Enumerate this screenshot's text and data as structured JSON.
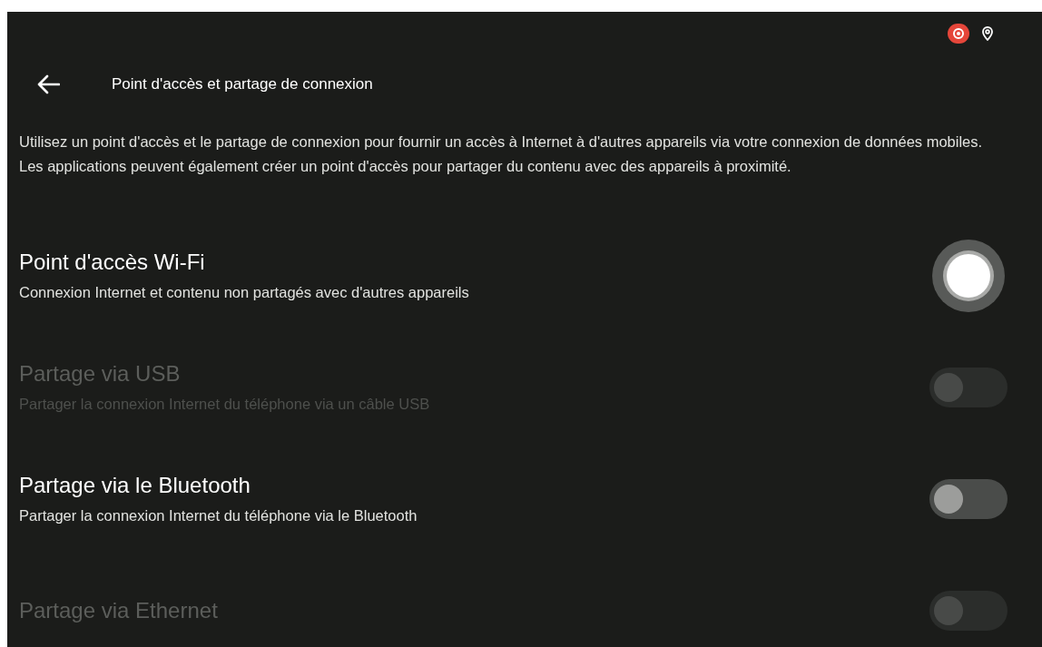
{
  "header": {
    "title": "Point d'accès et partage de connexion"
  },
  "description": "Utilisez un point d'accès et le partage de connexion pour fournir un accès à Internet à d'autres appareils via votre connexion de données mobiles. Les applications peuvent également créer un point d'accès pour partager du contenu avec des appareils à proximité.",
  "settings": [
    {
      "title": "Point d'accès Wi-Fi",
      "subtitle": "Connexion Internet et contenu non partagés avec d'autres appareils",
      "disabled": false,
      "checked": false,
      "pressed": true
    },
    {
      "title": "Partage via USB",
      "subtitle": "Partager la connexion Internet du téléphone via un câble USB",
      "disabled": true,
      "checked": false,
      "pressed": false
    },
    {
      "title": "Partage via le Bluetooth",
      "subtitle": "Partager la connexion Internet du téléphone via le Bluetooth",
      "disabled": false,
      "checked": false,
      "pressed": false
    },
    {
      "title": "Partage via Ethernet",
      "disabled": true,
      "checked": false,
      "pressed": false
    }
  ]
}
